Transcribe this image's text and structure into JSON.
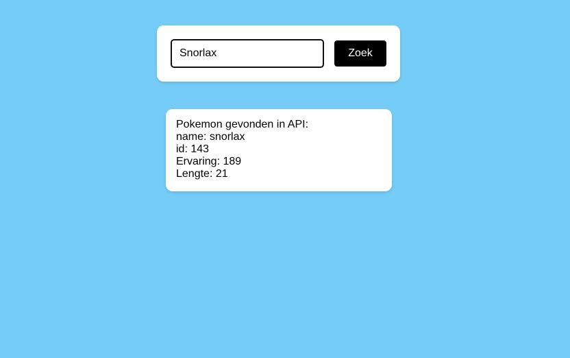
{
  "search": {
    "value": "Snorlax",
    "button_label": "Zoek"
  },
  "result": {
    "heading": "Pokemon gevonden in API:",
    "name_line": "name: snorlax",
    "id_line": "id: 143",
    "experience_line": "Ervaring: 189",
    "height_line": "Lengte: 21"
  },
  "colors": {
    "background": "#75cdf7",
    "card": "#ffffff",
    "button": "#000000",
    "button_text": "#ffffff"
  }
}
